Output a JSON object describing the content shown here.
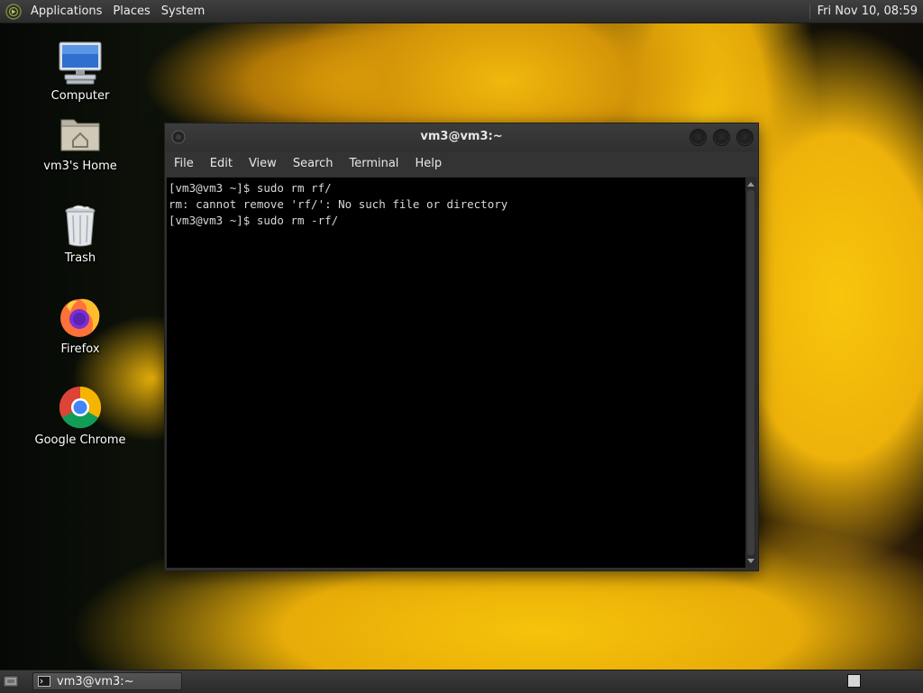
{
  "top_panel": {
    "menus": [
      "Applications",
      "Places",
      "System"
    ],
    "clock": "Fri Nov 10, 08:59"
  },
  "desktop": {
    "icons": [
      {
        "label": "Computer",
        "icon": "computer-icon"
      },
      {
        "label": "vm3's Home",
        "icon": "home-folder-icon"
      },
      {
        "label": "Trash",
        "icon": "trash-icon"
      },
      {
        "label": "Firefox",
        "icon": "firefox-icon"
      },
      {
        "label": "Google Chrome",
        "icon": "chrome-icon"
      }
    ]
  },
  "terminal": {
    "title": "vm3@vm3:~",
    "menus": [
      "File",
      "Edit",
      "View",
      "Search",
      "Terminal",
      "Help"
    ],
    "lines": [
      "[vm3@vm3 ~]$ sudo rm rf/",
      "rm: cannot remove 'rf/': No such file or directory",
      "[vm3@vm3 ~]$ sudo rm -rf/"
    ]
  },
  "taskbar": {
    "window_label": "vm3@vm3:~"
  },
  "colors": {
    "panel": "#333333",
    "terminal_bg": "#000000",
    "terminal_text": "#d8d8d8",
    "wallpaper_accent": "#f2bb0b"
  }
}
